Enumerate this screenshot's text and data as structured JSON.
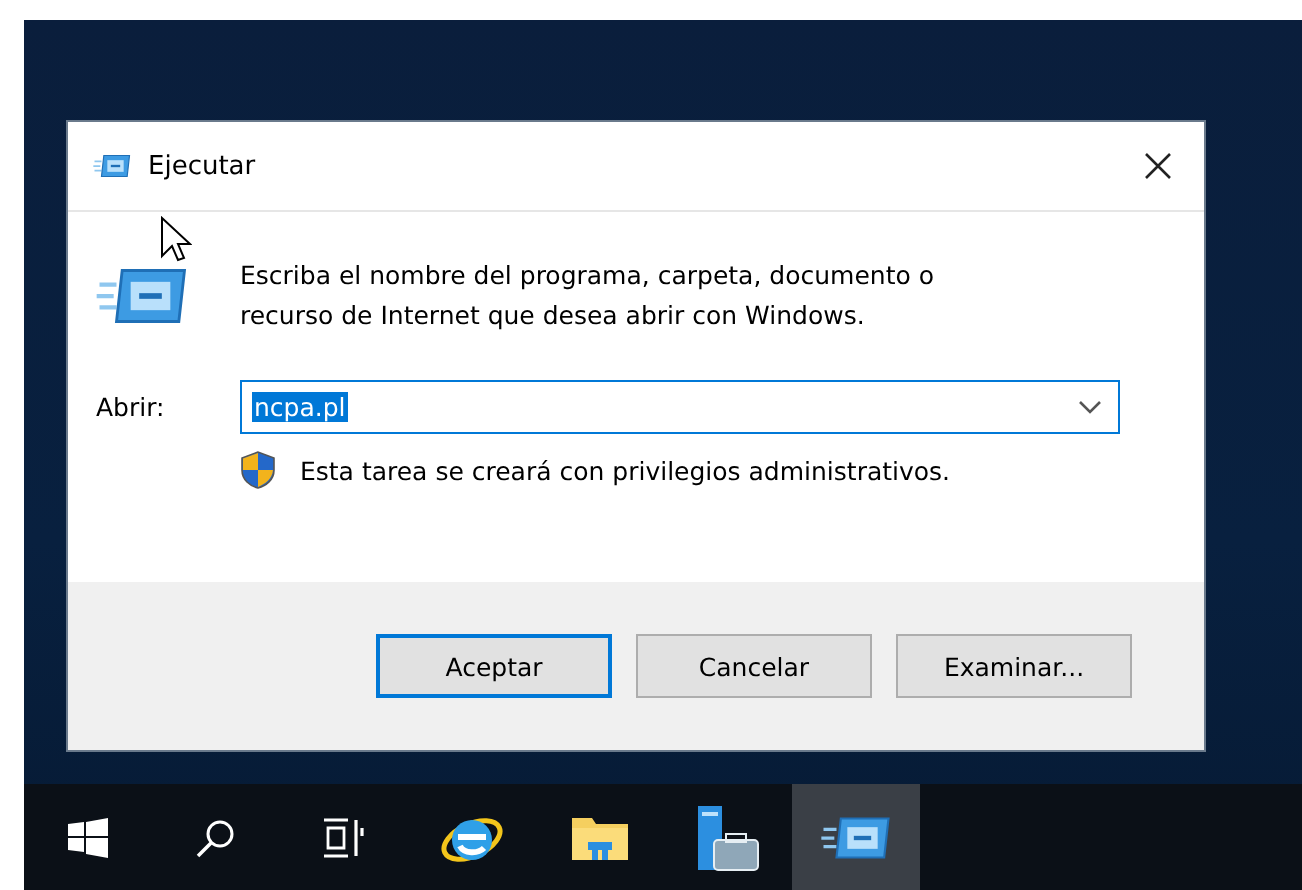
{
  "window": {
    "title": "Ejecutar"
  },
  "dialog": {
    "message": "Escriba el nombre del programa, carpeta, documento o recurso de Internet que desea abrir con Windows.",
    "open_label": "Abrir:",
    "open_value": "ncpa.pl",
    "value_selected": true,
    "admin_note": "Esta tarea se creará con privilegios administrativos."
  },
  "buttons": [
    {
      "label": "Aceptar",
      "default": true
    },
    {
      "label": "Cancelar",
      "default": false
    },
    {
      "label": "Examinar...",
      "default": false
    }
  ],
  "taskbar": [
    {
      "kind": "start",
      "selected": false
    },
    {
      "kind": "search",
      "selected": false
    },
    {
      "kind": "taskview",
      "selected": false
    },
    {
      "kind": "browser",
      "selected": false
    },
    {
      "kind": "folder",
      "selected": false
    },
    {
      "kind": "server",
      "selected": false
    },
    {
      "kind": "run",
      "selected": true
    }
  ]
}
